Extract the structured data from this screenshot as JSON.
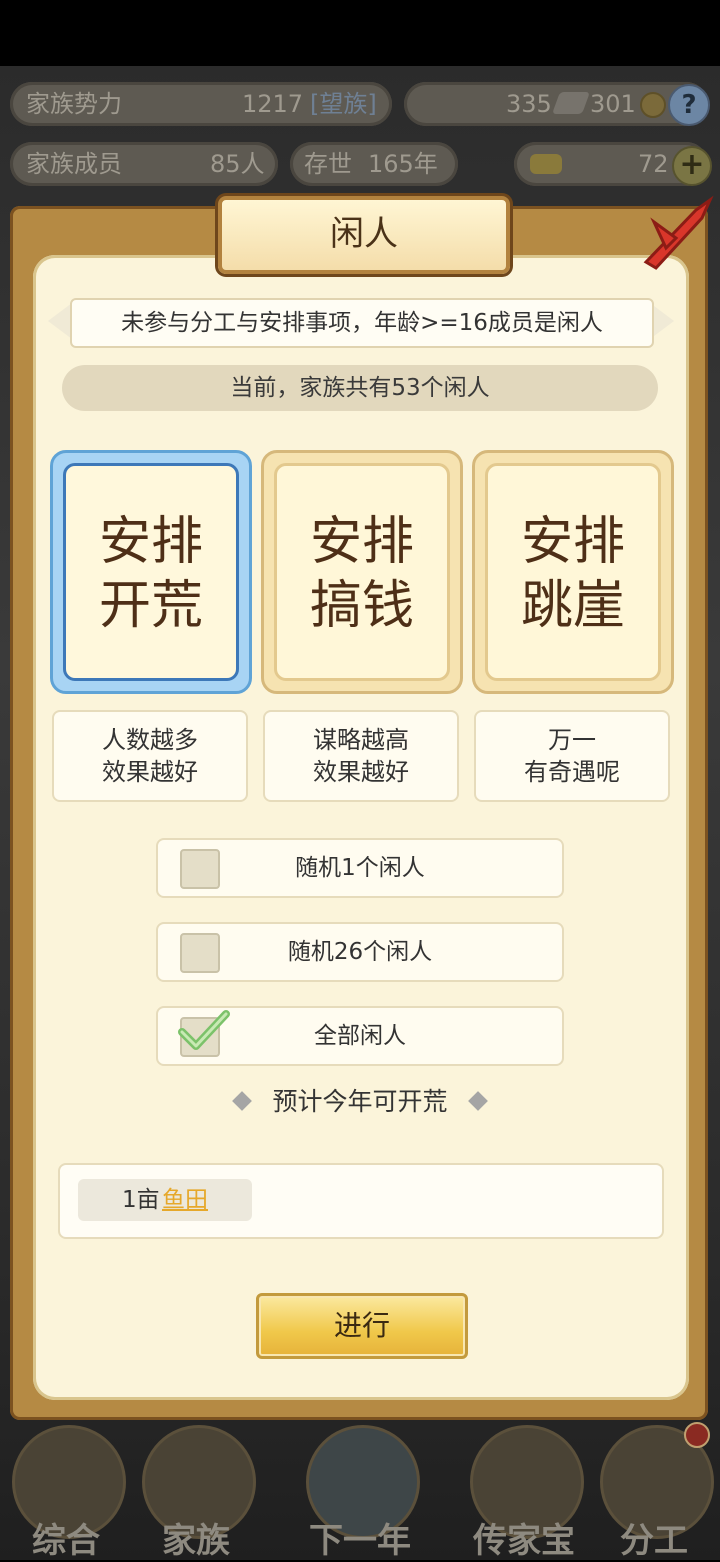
{
  "hud": {
    "power_label": "家族势力",
    "power_value": "1217",
    "power_rank": "[望族]",
    "resource1": "335",
    "resource2": "301",
    "members_label": "家族成员",
    "members_value": "85人",
    "age_label": "存世",
    "age_value": "165年",
    "gold_value": "72",
    "help": "?",
    "plus": "+"
  },
  "dialog": {
    "title": "闲人",
    "description": "未参与分工与安排事项，年龄>=16成员是闲人",
    "count_text": "当前，家族共有53个闲人",
    "options": [
      {
        "label": "安排\n开荒",
        "hint": "人数越多\n效果越好",
        "selected": true
      },
      {
        "label": "安排\n搞钱",
        "hint": "谋略越高\n效果越好",
        "selected": false
      },
      {
        "label": "安排\n跳崖",
        "hint": "万一\n有奇遇呢",
        "selected": false
      }
    ],
    "choices": [
      {
        "label": "随机1个闲人",
        "checked": false
      },
      {
        "label": "随机26个闲人",
        "checked": false
      },
      {
        "label": "全部闲人",
        "checked": true
      }
    ],
    "estimate_label": "预计今年可开荒",
    "result_count": "1亩",
    "result_item": "鱼田",
    "proceed_button": "进行"
  },
  "nav": {
    "items": [
      "综合",
      "家族",
      "下一年",
      "传家宝",
      "分工"
    ]
  },
  "colors": {
    "accent_gold": "#f0c84a",
    "selected_blue": "#5fa3d6",
    "link_orange": "#e6a82a"
  }
}
